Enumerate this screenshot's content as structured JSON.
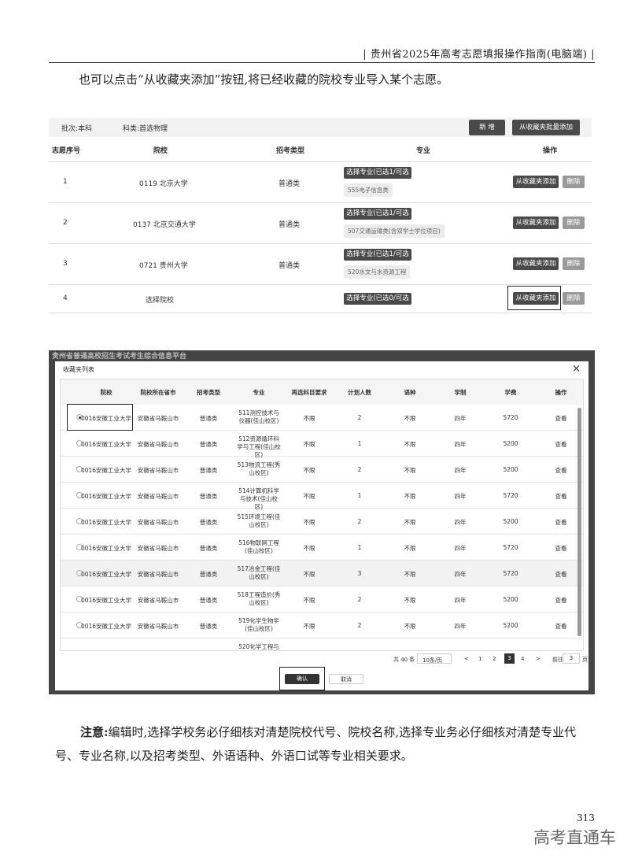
{
  "header": "| 贵州省2025年高考志愿填报操作指南(电脑端) |",
  "intro": "也可以点击“从收藏夹添加”按钮,将已经收藏的院校专业导入某个志愿。",
  "table1": {
    "batch": "批次:本科",
    "subject": "科类:首选物理",
    "new_btn": "新 增",
    "batch_add_btn": "从收藏夹批量添加",
    "headers": [
      "志愿序号",
      "院校",
      "招考类型",
      "专业",
      "操作"
    ],
    "rows": [
      {
        "no": "1",
        "school": "0119 北京大学",
        "type": "普通类",
        "select": "选择专业(已选1/可选1)",
        "major": "555电子信息类",
        "add": "从收藏夹添加",
        "del": "删除"
      },
      {
        "no": "2",
        "school": "0137 北京交通大学",
        "type": "普通类",
        "select": "选择专业(已选1/可选1)",
        "major": "507交通运输类(含双学士学位项目)",
        "add": "从收藏夹添加",
        "del": "删除"
      },
      {
        "no": "3",
        "school": "0721 贵州大学",
        "type": "普通类",
        "select": "选择专业(已选1/可选1)",
        "major": "520水文与水资源工程",
        "add": "从收藏夹添加",
        "del": "删除"
      },
      {
        "no": "4",
        "school": "选择院校",
        "type": "",
        "select": "选择专业(已选0/可选1)",
        "major": "",
        "add": "从收藏夹添加",
        "del": "删除"
      }
    ]
  },
  "dialog": {
    "banner": "贵州省普通高校招生考试考生综合信息平台",
    "title": "收藏夹列表",
    "close": "×",
    "headers": [
      "院校",
      "院校所在省市",
      "招考类型",
      "专业",
      "再选科目要求",
      "计划人数",
      "语种",
      "学制",
      "学费",
      "操作"
    ],
    "rows": [
      {
        "school": "0016安徽工业大学",
        "city": "安徽省马鞍山市",
        "type": "普通类",
        "major": "511测控技术与仪器(佳山校区)",
        "req": "不限",
        "plan": "2",
        "lang": "不限",
        "years": "四年",
        "fee": "5720",
        "op": "查看"
      },
      {
        "school": "0016安徽工业大学",
        "city": "安徽省马鞍山市",
        "type": "普通类",
        "major": "512资源循环科学与工程(佳山校区)",
        "req": "不限",
        "plan": "1",
        "lang": "不限",
        "years": "四年",
        "fee": "5200",
        "op": "查看"
      },
      {
        "school": "0016安徽工业大学",
        "city": "安徽省马鞍山市",
        "type": "普通类",
        "major": "513物流工程(秀山校区)",
        "req": "不限",
        "plan": "2",
        "lang": "不限",
        "years": "四年",
        "fee": "5200",
        "op": "查看"
      },
      {
        "school": "0016安徽工业大学",
        "city": "安徽省马鞍山市",
        "type": "普通类",
        "major": "514计算机科学与技术(佳山校区)",
        "req": "不限",
        "plan": "1",
        "lang": "不限",
        "years": "四年",
        "fee": "5720",
        "op": "查看"
      },
      {
        "school": "0016安徽工业大学",
        "city": "安徽省马鞍山市",
        "type": "普通类",
        "major": "515环境工程(佳山校区)",
        "req": "不限",
        "plan": "2",
        "lang": "不限",
        "years": "四年",
        "fee": "5200",
        "op": "查看"
      },
      {
        "school": "0016安徽工业大学",
        "city": "安徽省马鞍山市",
        "type": "普通类",
        "major": "516物联网工程(佳山校区)",
        "req": "不限",
        "plan": "1",
        "lang": "不限",
        "years": "四年",
        "fee": "5720",
        "op": "查看"
      },
      {
        "school": "0016安徽工业大学",
        "city": "安徽省马鞍山市",
        "type": "普通类",
        "major": "517冶金工程(佳山校区)",
        "req": "不限",
        "plan": "3",
        "lang": "不限",
        "years": "四年",
        "fee": "5720",
        "op": "查看"
      },
      {
        "school": "0016安徽工业大学",
        "city": "安徽省马鞍山市",
        "type": "普通类",
        "major": "518工程造价(秀山校区)",
        "req": "不限",
        "plan": "2",
        "lang": "不限",
        "years": "四年",
        "fee": "5200",
        "op": "查看"
      },
      {
        "school": "0016安徽工业大学",
        "city": "安徽省马鞍山市",
        "type": "普通类",
        "major": "519化学生物学(佳山校区)",
        "req": "不限",
        "plan": "2",
        "lang": "不限",
        "years": "四年",
        "fee": "5200",
        "op": "查看"
      },
      {
        "school": "",
        "city": "",
        "type": "",
        "major": "520化学工程与工",
        "req": "",
        "plan": "",
        "lang": "",
        "years": "",
        "fee": "",
        "op": ""
      }
    ],
    "pager": {
      "total": "共 40 条",
      "size": "10条/页",
      "prev": "<",
      "pages": [
        "1",
        "2",
        "3",
        "4"
      ],
      "current": "3",
      "next": ">",
      "goto": "前往",
      "goto_val": "3",
      "unit": "页"
    },
    "confirm": "确认",
    "cancel": "取消"
  },
  "note": {
    "label": "注意:",
    "text": "编辑时,选择学校务必仔细核对清楚院校代号、院校名称,选择专业务必仔细核对清楚专业代号、专业名称,以及招考类型、外语语种、外语口试等专业相关要求。"
  },
  "page_number": "313",
  "watermark": "高考直通车"
}
